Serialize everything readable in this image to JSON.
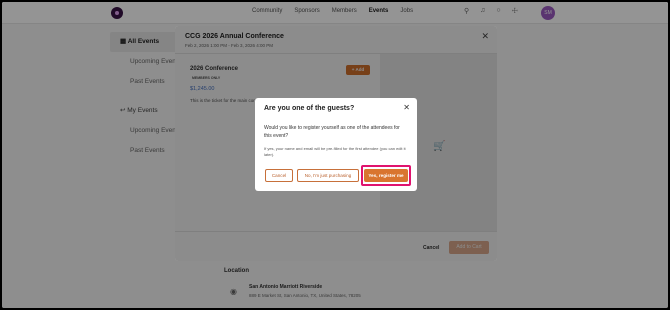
{
  "nav": {
    "links": [
      "Community",
      "Sponsors",
      "Members",
      "Events",
      "Jobs"
    ],
    "active": "Events",
    "avatar_initials": "SM",
    "icons": [
      "search-icon",
      "bell-icon",
      "chat-icon",
      "cart-icon"
    ]
  },
  "sidebar": {
    "items": [
      {
        "label": "All Events",
        "icon": "calendar-icon"
      },
      {
        "label": "Upcoming Events"
      },
      {
        "label": "Past Events"
      },
      {
        "label": "My Events",
        "icon": "user-icon"
      },
      {
        "label": "Upcoming Events"
      },
      {
        "label": "Past Events"
      }
    ]
  },
  "location": {
    "title": "Location",
    "name": "San Antonio Marriott Riverside",
    "address": "889 E Market St, San Antonio, TX, United States, 78205"
  },
  "event_modal": {
    "title": "CCG 2026 Annual Conference",
    "dates": "Feb 2, 2026 1:00 PM - Feb 3, 2026 4:00 PM",
    "ticket": {
      "name": "2026 Conference",
      "badge": "MEMBERS ONLY",
      "price": "$1,245.00",
      "description": "This is the ticket for the main conference.",
      "add_label": "+ Add"
    },
    "cancel_label": "Cancel",
    "add_to_cart_label": "Add to Cart"
  },
  "guest_dialog": {
    "title": "Are you one of the guests?",
    "question": "Would you like to register yourself as one of the attendees for this event?",
    "note": "If yes, your name and email will be pre-filled for the first attendee (you can edit it later).",
    "cancel_label": "Cancel",
    "purchasing_label": "No, I'm just purchasing",
    "register_label": "Yes, register me"
  },
  "colors": {
    "accent": "#d9752f",
    "highlight": "#e0136e",
    "price": "#4a76c9"
  }
}
